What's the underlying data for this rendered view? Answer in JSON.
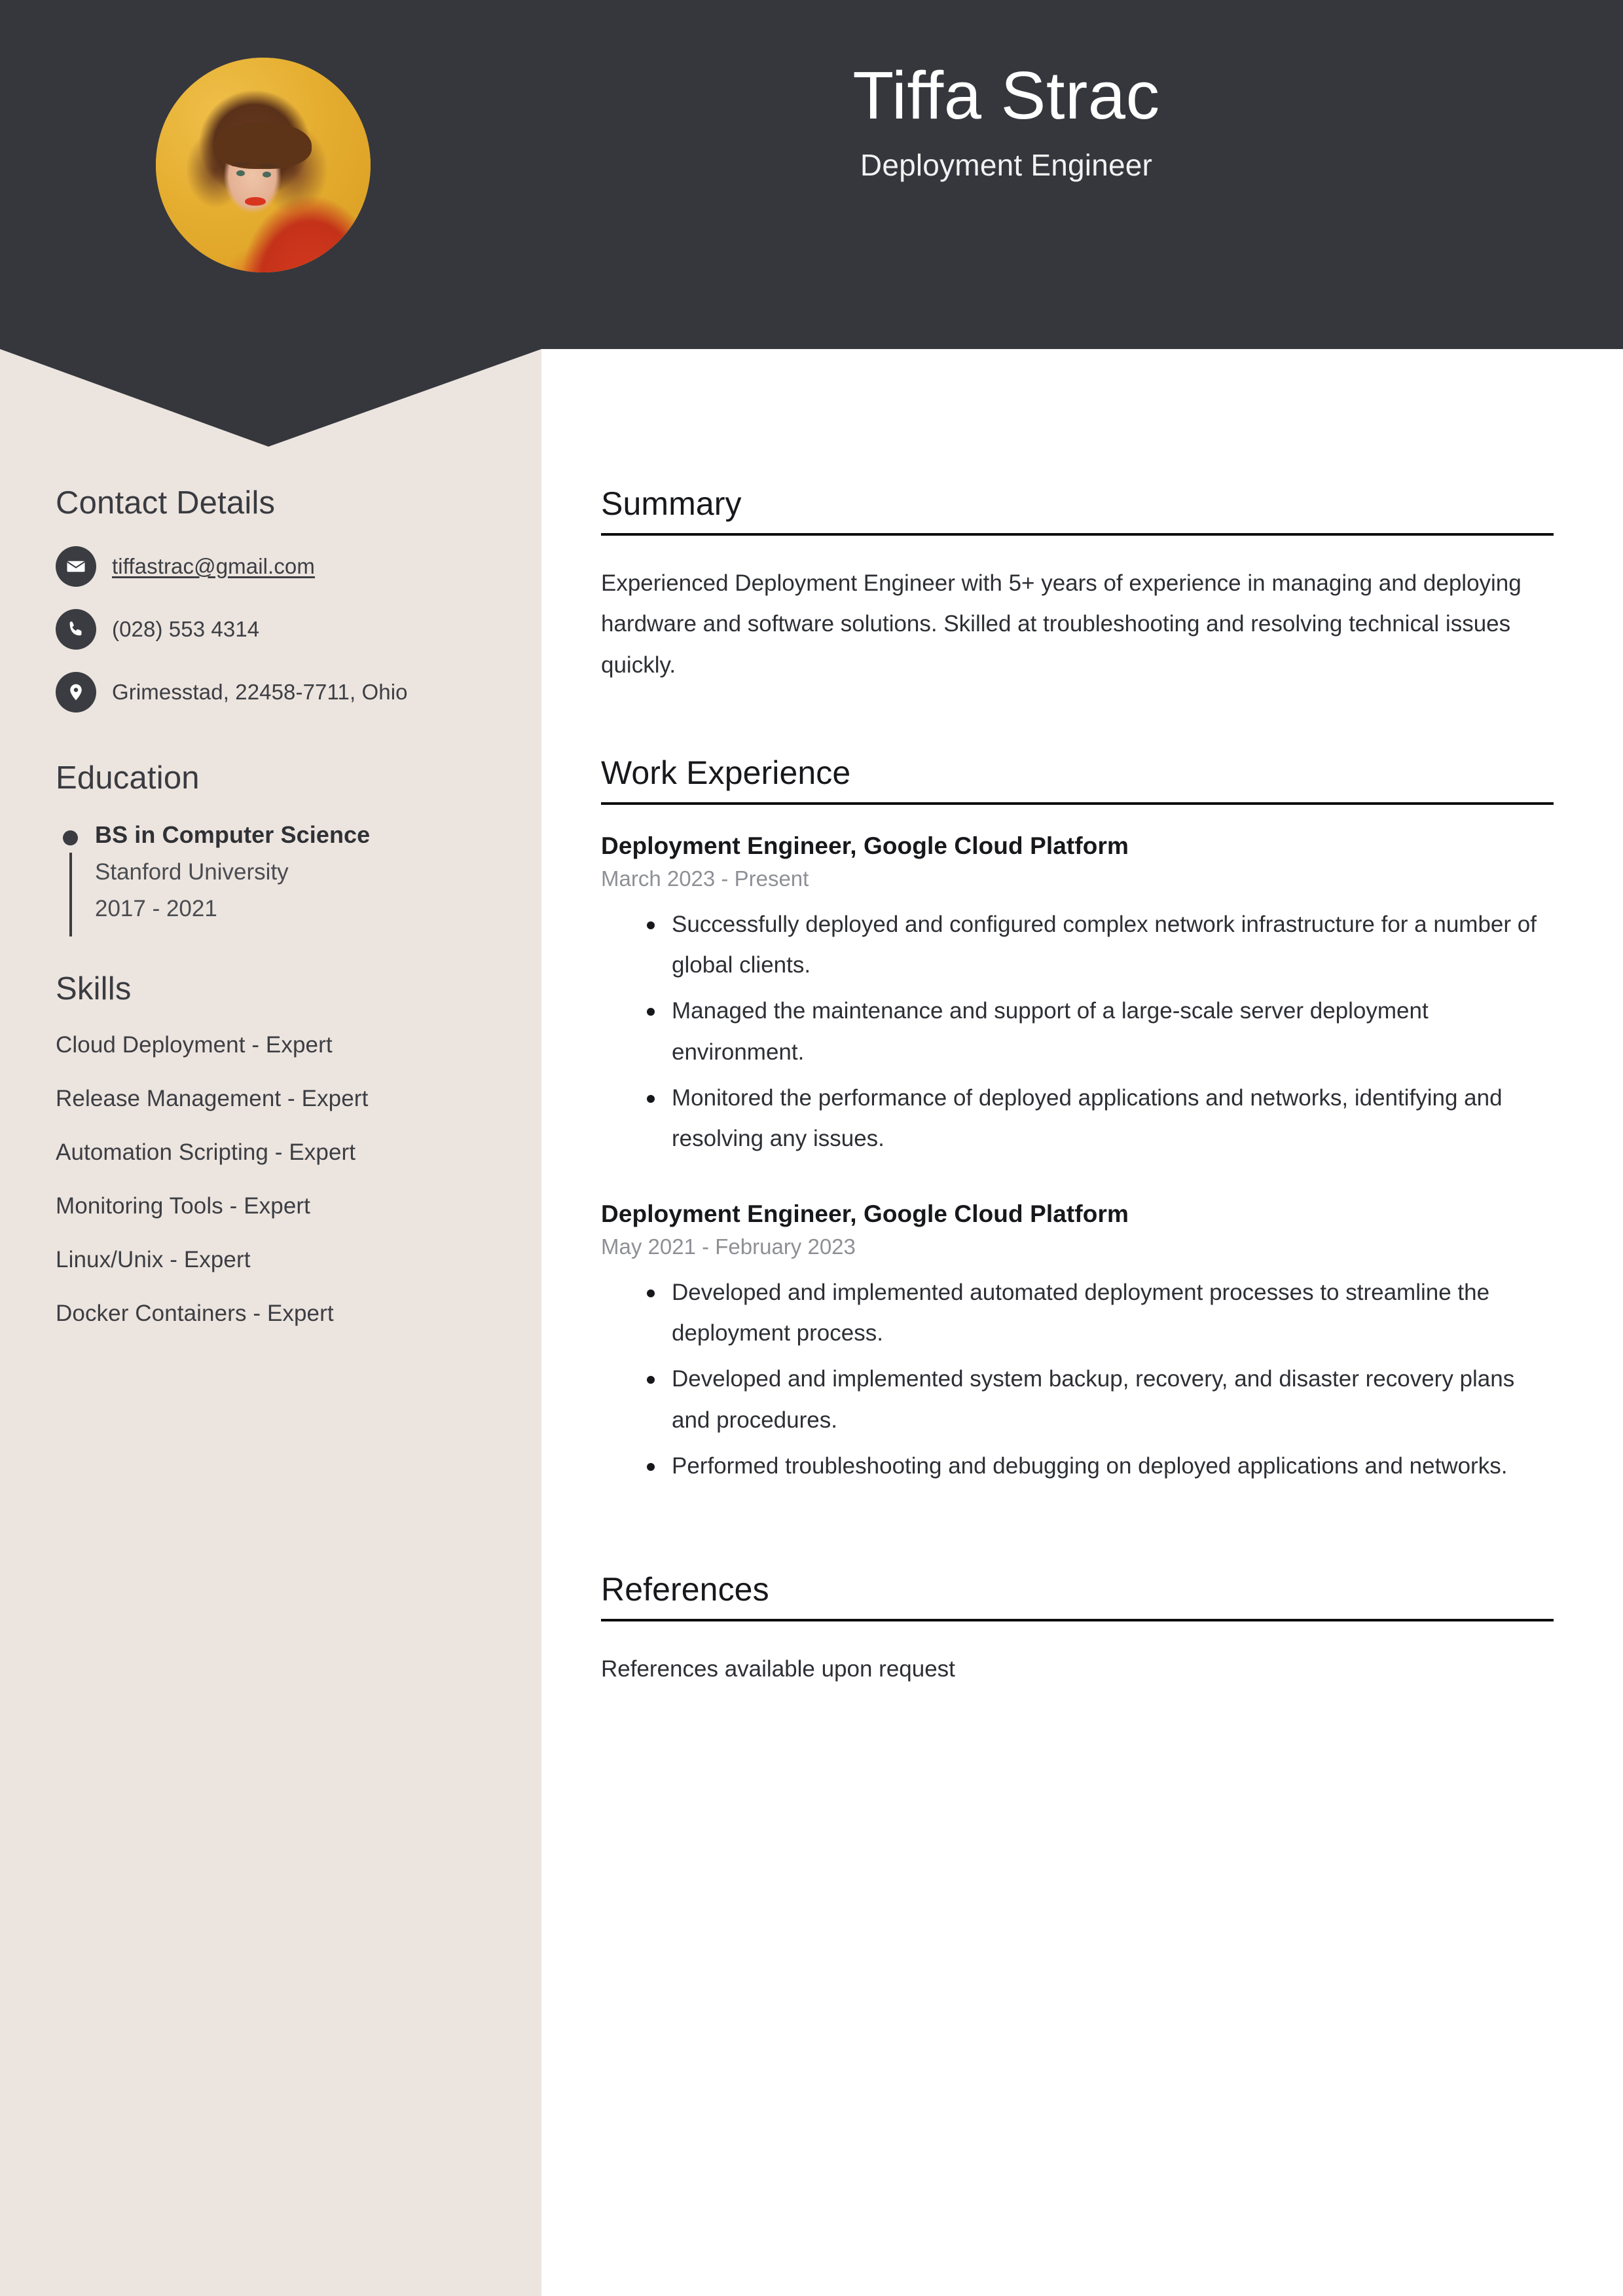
{
  "theme": {
    "header_bg": "#35373D",
    "sidebar_bg": "#ECE4DE",
    "page_bg": "#FFFFFF",
    "accent_photo_bg": "#E0A92C",
    "rule_color": "#0B0C0E",
    "muted_text": "#8E9095"
  },
  "header": {
    "name": "Tiffa Strac",
    "job_title": "Deployment Engineer",
    "avatar_alt": "Portrait photo of a woman with curly auburn hair wearing a red top on an amber background"
  },
  "sidebar": {
    "contact": {
      "heading": "Contact Details",
      "items": [
        {
          "icon": "envelope-icon",
          "value": "tiffastrac@gmail.com",
          "is_link": true
        },
        {
          "icon": "phone-icon",
          "value": "(028) 553 4314",
          "is_link": false
        },
        {
          "icon": "map-pin-icon",
          "value": "Grimesstad, 22458-7711, Ohio",
          "is_link": false
        }
      ]
    },
    "education": {
      "heading": "Education",
      "items": [
        {
          "degree": "BS in Computer Science",
          "school": "Stanford University",
          "dates": "2017 - 2021"
        }
      ]
    },
    "skills": {
      "heading": "Skills",
      "items": [
        "Cloud Deployment - Expert",
        "Release Management - Expert",
        "Automation Scripting - Expert",
        "Monitoring Tools - Expert",
        "Linux/Unix - Expert",
        "Docker Containers - Expert"
      ]
    }
  },
  "main": {
    "summary": {
      "heading": "Summary",
      "text": "Experienced Deployment Engineer with 5+ years of experience in managing and deploying hardware and software solutions. Skilled at troubleshooting and resolving technical issues quickly."
    },
    "work_experience": {
      "heading": "Work Experience",
      "jobs": [
        {
          "title": "Deployment Engineer, Google Cloud Platform",
          "dates": "March 2023 - Present",
          "bullets": [
            "Successfully deployed and configured complex network infrastructure for a number of global clients.",
            "Managed the maintenance and support of a large-scale server deployment environment.",
            "Monitored the performance of deployed applications and networks, identifying and resolving any issues."
          ]
        },
        {
          "title": "Deployment Engineer, Google Cloud Platform",
          "dates": "May 2021 - February 2023",
          "bullets": [
            "Developed and implemented automated deployment processes to streamline the deployment process.",
            "Developed and implemented system backup, recovery, and disaster recovery plans and procedures.",
            "Performed troubleshooting and debugging on deployed applications and networks."
          ]
        }
      ]
    },
    "references": {
      "heading": "References",
      "text": "References available upon request"
    }
  }
}
